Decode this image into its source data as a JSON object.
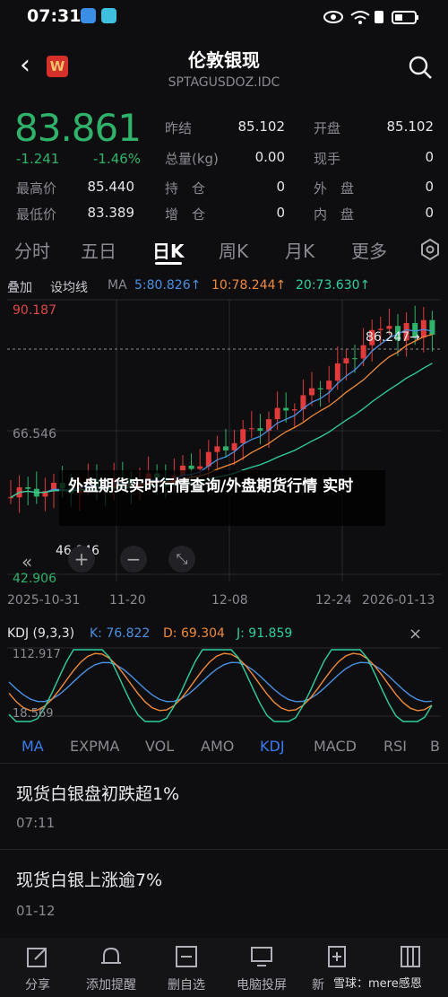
{
  "status": {
    "time": "07:31"
  },
  "header": {
    "title": "伦敦银现",
    "code": "SPTAGUSDOZ.IDC",
    "logo": "W"
  },
  "quote": {
    "price": "83.861",
    "change": "-1.241",
    "change_pct": "-1.46%",
    "stats": [
      {
        "label": "昨结",
        "value": "85.102"
      },
      {
        "label": "开盘",
        "value": "85.102"
      },
      {
        "label": "总量(kg)",
        "value": "0.00"
      },
      {
        "label": "现手",
        "value": "0"
      },
      {
        "label": "最高价",
        "value": "85.440"
      },
      {
        "label": "持　仓",
        "value": "0"
      },
      {
        "label": "外　盘",
        "value": "0"
      },
      {
        "label": "最低价",
        "value": "83.389"
      },
      {
        "label": "增　仓",
        "value": "0"
      },
      {
        "label": "内　盘",
        "value": "0"
      }
    ]
  },
  "tabs": [
    "分时",
    "五日",
    "日K",
    "周K",
    "月K",
    "更多"
  ],
  "ma_bar": {
    "overlay": "叠加",
    "setting": "设均线",
    "ma": "MA",
    "ma5": "5:80.826↑",
    "ma10": "10:78.244↑",
    "ma20": "20:73.630↑"
  },
  "chart_data": {
    "type": "candlestick",
    "y_ticks": [
      "90.187",
      "66.546",
      "42.906"
    ],
    "price_line_label": "86.247→",
    "low_label": "46.846",
    "x_ticks": [
      "2025-10-31",
      "11-20",
      "12-08",
      "12-24",
      "2026-01-13"
    ],
    "ylim": [
      42.906,
      90.187
    ]
  },
  "kdj": {
    "name": "KDJ (9,3,3)",
    "k": "K: 76.822",
    "d": "D: 69.304",
    "j": "J: 91.859",
    "top": "112.917",
    "bottom": "18.569"
  },
  "indicators": [
    "MA",
    "EXPMA",
    "VOL",
    "AMO",
    "KDJ",
    "MACD",
    "RSI",
    "B"
  ],
  "news": [
    {
      "title": "现货白银盘初跌超1%",
      "time": "07:11"
    },
    {
      "title": "现货白银上涨逾7%",
      "time": "01-12"
    }
  ],
  "overlay": {
    "text": "外盘期货实时行情查询/外盘期货行情 实时"
  },
  "bottom_bar": [
    "分享",
    "添加提醒",
    "删自选",
    "电脑投屏",
    "新",
    "雪球"
  ],
  "watermark": "雪球：mere感恩",
  "colors": {
    "up": "#e03a3a",
    "down": "#2fb36b",
    "ma5": "#4a90e2",
    "ma10": "#f08a3a",
    "ma20": "#2fd0a0",
    "accent": "#3a7cf0"
  }
}
